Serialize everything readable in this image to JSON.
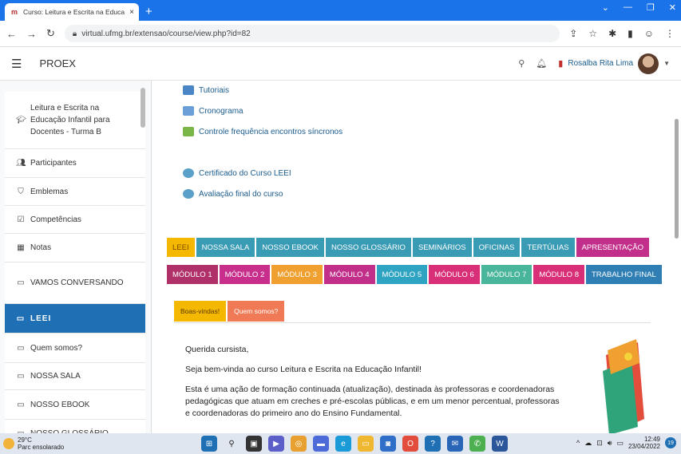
{
  "browser": {
    "tab_title": "Curso: Leitura e Escrita na Educa",
    "tab_close": "×",
    "new_tab": "+",
    "url": "virtual.ufmg.br/extensao/course/view.php?id=82"
  },
  "header": {
    "site_name": "PROEX",
    "user_name": "Rosalba Rita Lima"
  },
  "sidebar": {
    "items": [
      {
        "label": "Leitura e Escrita na Educação Infantil para Docentes - Turma B",
        "icon": "graduation-cap-icon"
      },
      {
        "label": "Participantes",
        "icon": "users-icon"
      },
      {
        "label": "Emblemas",
        "icon": "shield-icon"
      },
      {
        "label": "Competências",
        "icon": "checkbox-icon"
      },
      {
        "label": "Notas",
        "icon": "table-icon"
      },
      {
        "label": "VAMOS CONVERSANDO",
        "icon": "folder-icon"
      },
      {
        "label": "LEEI",
        "icon": "folder-icon"
      },
      {
        "label": "Quem somos?",
        "icon": "folder-icon"
      },
      {
        "label": "NOSSA SALA",
        "icon": "folder-icon"
      },
      {
        "label": "NOSSO EBOOK",
        "icon": "folder-icon"
      },
      {
        "label": "NOSSO GLOSSÁRIO",
        "icon": "folder-icon"
      }
    ]
  },
  "resources": [
    {
      "label": "Tutoriais",
      "icon": "folder-icon"
    },
    {
      "label": "Cronograma",
      "icon": "file-icon"
    },
    {
      "label": "Controle frequência encontros síncronos",
      "icon": "attendance-icon"
    },
    {
      "label": "Certificado do Curso LEEI",
      "icon": "certificate-icon"
    },
    {
      "label": "Avaliação final do curso",
      "icon": "feedback-icon"
    }
  ],
  "tabs_row1": [
    {
      "label": "LEEI",
      "color": "#f5b800",
      "text": "#7a4a00"
    },
    {
      "label": "NOSSA SALA",
      "color": "#3a9bb5"
    },
    {
      "label": "NOSSO EBOOK",
      "color": "#3a9bb5"
    },
    {
      "label": "NOSSO GLOSSÁRIO",
      "color": "#3a9bb5"
    },
    {
      "label": "SEMINÁRIOS",
      "color": "#3a9bb5"
    },
    {
      "label": "OFICINAS",
      "color": "#3a9bb5"
    },
    {
      "label": "TERTÚLIAS",
      "color": "#3a9bb5"
    },
    {
      "label": "APRESENTAÇÃO",
      "color": "#c22f8a"
    }
  ],
  "tabs_row2": [
    {
      "label": "MÓDULO 1",
      "color": "#b0306a"
    },
    {
      "label": "MÓDULO 2",
      "color": "#c82f8d"
    },
    {
      "label": "MÓDULO 3",
      "color": "#f0a030"
    },
    {
      "label": "MÓDULO 4",
      "color": "#c22f8a"
    },
    {
      "label": "MÓDULO 5",
      "color": "#2fa3c2"
    },
    {
      "label": "MÓDULO 6",
      "color": "#d92f78"
    },
    {
      "label": "MÓDULO 7",
      "color": "#49b59a"
    },
    {
      "label": "MÓDULO 8",
      "color": "#d92f78"
    },
    {
      "label": "TRABALHO FINAL",
      "color": "#2f7fb5"
    }
  ],
  "subtabs": [
    {
      "label": "Boas-vindas!",
      "color": "#f5b800",
      "text": "#5a3a00"
    },
    {
      "label": "Quem somos?",
      "color": "#f07a55",
      "text": "#fff"
    }
  ],
  "content": {
    "greeting": "Querida cursista,",
    "welcome": "Seja bem-vinda ao curso Leitura e Escrita na Educação Infantil!",
    "body": "Esta é uma ação de formação continuada (atualização), destinada às professoras e coordenadoras pedagógicas que atuam em creches e pré-escolas públicas, e em um menor percentual, professoras e coordenadoras do primeiro ano do Ensino Fundamental."
  },
  "taskbar": {
    "temp": "29°C",
    "weather": "Parc ensolarado",
    "time": "12:49",
    "date": "23/04/2022",
    "notifications": "19"
  }
}
